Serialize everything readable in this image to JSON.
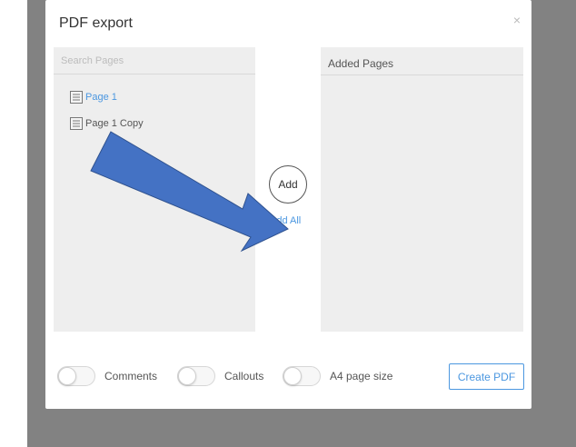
{
  "modal": {
    "title": "PDF export",
    "close_glyph": "×"
  },
  "source_panel": {
    "search_placeholder": "Search Pages",
    "pages": [
      {
        "label": "Page 1",
        "icon": "document-icon",
        "state": "selected"
      },
      {
        "label": "Page 1 Copy",
        "icon": "document-icon",
        "state": "normal"
      }
    ]
  },
  "added_panel": {
    "header": "Added Pages"
  },
  "actions": {
    "add_label": "Add",
    "add_all_label": "Add All"
  },
  "options": [
    {
      "label": "Comments",
      "on": false
    },
    {
      "label": "Callouts",
      "on": false
    },
    {
      "label": "A4 page size",
      "on": false
    }
  ],
  "footer": {
    "create_label": "Create PDF"
  },
  "annotation": {
    "icon": "blue-arrow-annotation",
    "color": "#4472c4",
    "stroke": "#2f528f"
  },
  "colors": {
    "accent": "#4b97e0",
    "overlay": "#828282",
    "panel_bg": "#eeeeee"
  }
}
